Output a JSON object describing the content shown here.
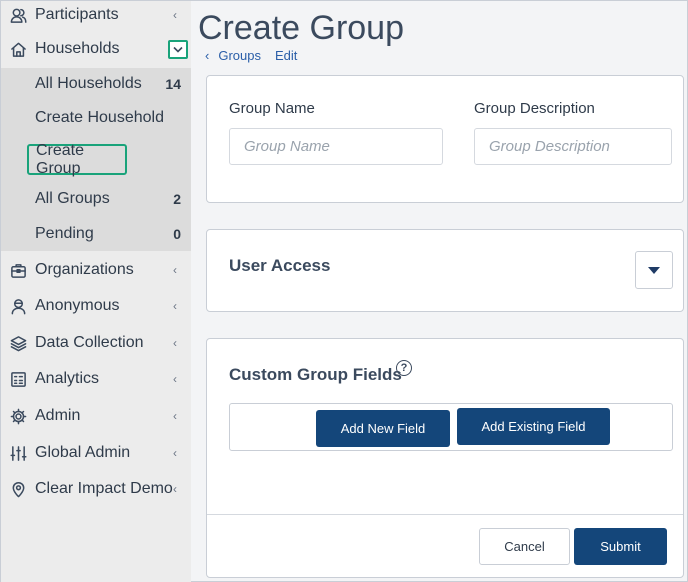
{
  "sidebar": {
    "items": [
      {
        "label": "Participants",
        "icon": "participants-icon"
      },
      {
        "label": "Households",
        "icon": "home-icon"
      },
      {
        "label": "Organizations",
        "icon": "briefcase-icon"
      },
      {
        "label": "Anonymous",
        "icon": "anonymous-user-icon"
      },
      {
        "label": "Data Collection",
        "icon": "layers-icon"
      },
      {
        "label": "Analytics",
        "icon": "analytics-icon"
      },
      {
        "label": "Admin",
        "icon": "gear-icon"
      },
      {
        "label": "Global Admin",
        "icon": "sliders-icon"
      },
      {
        "label": "Clear Impact Demo",
        "icon": "map-pin-icon"
      }
    ],
    "households_sub": [
      {
        "label": "All Households",
        "count": "14"
      },
      {
        "label": "Create Household",
        "count": ""
      },
      {
        "label": "Create Group",
        "count": ""
      },
      {
        "label": "All Groups",
        "count": "2"
      },
      {
        "label": "Pending",
        "count": "0"
      }
    ],
    "chevron": "‹"
  },
  "page": {
    "title": "Create Group",
    "breadcrumb": {
      "parent": "Groups",
      "current": "Edit"
    }
  },
  "form": {
    "group_name_label": "Group Name",
    "group_name_placeholder": "Group Name",
    "group_description_label": "Group Description",
    "group_description_placeholder": "Group Description"
  },
  "user_access": {
    "title": "User Access"
  },
  "custom_fields": {
    "title": "Custom Group Fields",
    "help": "?",
    "add_new_label": "Add New Field",
    "add_existing_label": "Add Existing Field"
  },
  "footer": {
    "cancel_label": "Cancel",
    "submit_label": "Submit"
  },
  "colors": {
    "accent": "#14467a",
    "highlight": "#19a37a",
    "link": "#2a5ea8"
  }
}
